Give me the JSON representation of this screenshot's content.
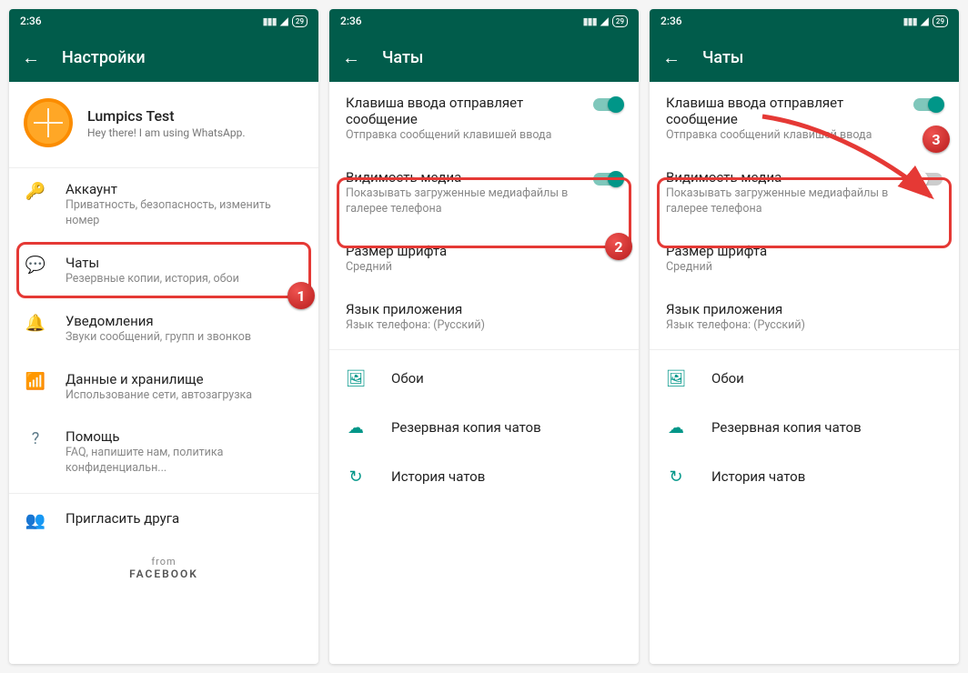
{
  "status": {
    "time": "2:36",
    "battery": "29"
  },
  "screen1": {
    "title": "Настройки",
    "profile": {
      "name": "Lumpics Test",
      "status": "Hey there! I am using WhatsApp."
    },
    "items": [
      {
        "icon": "key",
        "title": "Аккаунт",
        "sub": "Приватность, безопасность, изменить номер"
      },
      {
        "icon": "chat",
        "title": "Чаты",
        "sub": "Резервные копии, история, обои"
      },
      {
        "icon": "bell",
        "title": "Уведомления",
        "sub": "Звуки сообщений, групп и звонков"
      },
      {
        "icon": "data",
        "title": "Данные и хранилище",
        "sub": "Использование сети, автозагрузка"
      },
      {
        "icon": "help",
        "title": "Помощь",
        "sub": "FAQ, напишите нам, политика конфиденциальн..."
      },
      {
        "icon": "invite",
        "title": "Пригласить друга",
        "sub": ""
      }
    ],
    "footer_from": "from",
    "footer_brand": "FACEBOOK"
  },
  "screen2": {
    "title": "Чаты",
    "settings": [
      {
        "title": "Клавиша ввода отправляет сообщение",
        "sub": "Отправка сообщений клавишей ввода",
        "toggle": "on"
      },
      {
        "title": "Видимость медиа",
        "sub": "Показывать загруженные медиафайлы в галерее телефона",
        "toggle": "on"
      },
      {
        "title": "Размер шрифта",
        "sub": "Средний"
      },
      {
        "title": "Язык приложения",
        "sub": "Язык телефона: (Русский)"
      }
    ],
    "actions": [
      {
        "icon": "wallpaper",
        "label": "Обои"
      },
      {
        "icon": "cloud-up",
        "label": "Резервная копия чатов"
      },
      {
        "icon": "history",
        "label": "История чатов"
      }
    ]
  },
  "screen3": {
    "title": "Чаты",
    "settings": [
      {
        "title": "Клавиша ввода отправляет сообщение",
        "sub": "Отправка сообщений клавишей ввода",
        "toggle": "on"
      },
      {
        "title": "Видимость медиа",
        "sub": "Показывать загруженные медиафайлы в галерее телефона",
        "toggle": "off"
      },
      {
        "title": "Размер шрифта",
        "sub": "Средний"
      },
      {
        "title": "Язык приложения",
        "sub": "Язык телефона: (Русский)"
      }
    ],
    "actions": [
      {
        "icon": "wallpaper",
        "label": "Обои"
      },
      {
        "icon": "cloud-up",
        "label": "Резервная копия чатов"
      },
      {
        "icon": "history",
        "label": "История чатов"
      }
    ]
  },
  "steps": {
    "1": "1",
    "2": "2",
    "3": "3"
  }
}
